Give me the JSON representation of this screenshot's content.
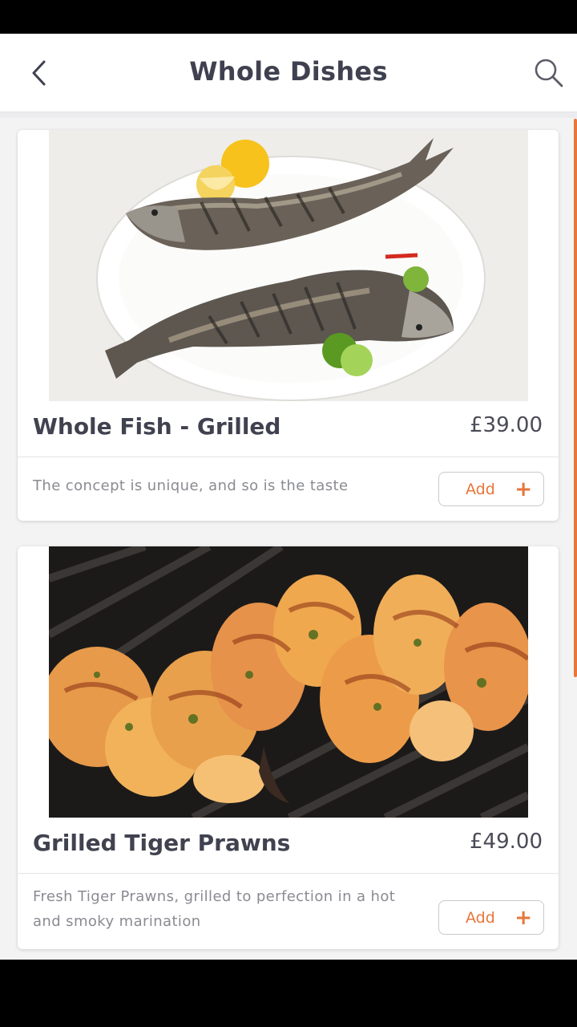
{
  "header": {
    "title": "Whole Dishes",
    "back_icon": "chevron-left-icon",
    "search_icon": "search-icon"
  },
  "colors": {
    "accent": "#e7763a",
    "title": "#3f4150",
    "text_muted": "#8a8b92",
    "background": "#f3f3f4"
  },
  "dishes": [
    {
      "name": "Whole Fish - Grilled",
      "price": "£39.00",
      "description": "The concept is unique, and so is the taste",
      "add_label": "Add",
      "image": "grilled-fish-photo"
    },
    {
      "name": "Grilled Tiger Prawns",
      "price": "£49.00",
      "description": "Fresh Tiger Prawns, grilled to perfection in a hot and smoky marination",
      "add_label": "Add",
      "image": "grilled-prawns-photo"
    }
  ]
}
